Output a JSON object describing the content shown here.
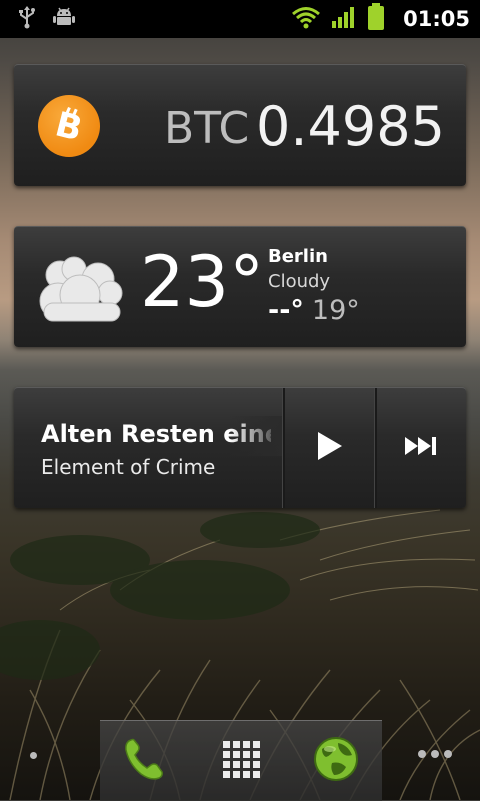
{
  "status_bar": {
    "time": "01:05",
    "icons": [
      "usb-icon",
      "android-debug-icon",
      "wifi-icon",
      "signal-icon",
      "battery-icon"
    ]
  },
  "bitcoin_widget": {
    "currency": "BTC",
    "value": "0.4985",
    "logo_icon": "bitcoin-icon"
  },
  "weather_widget": {
    "temperature": "23°",
    "city": "Berlin",
    "condition": "Cloudy",
    "high": "--°",
    "low": "19°",
    "icon": "cloudy-icon"
  },
  "music_widget": {
    "track_title": "Alten Resten eine",
    "artist": "Element of Crime",
    "controls": [
      "play-icon",
      "next-track-icon"
    ]
  },
  "dock": {
    "items": [
      "phone-icon",
      "app-drawer-icon",
      "browser-icon"
    ]
  },
  "colors": {
    "btc_orange": "#f7931a",
    "battery_green": "#9fd22b",
    "wifi_green": "#9fd22b"
  }
}
